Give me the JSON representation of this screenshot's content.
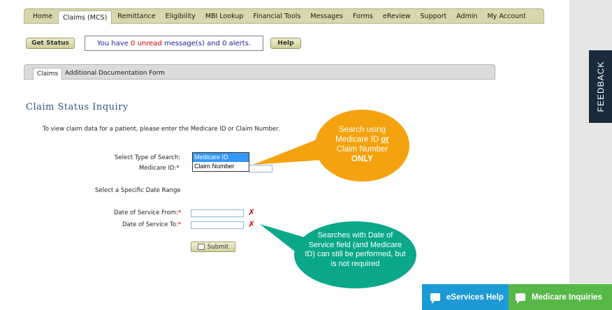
{
  "nav": {
    "items": [
      "Home",
      "Claims (MCS)",
      "Remittance",
      "Eligibility",
      "MBI Lookup",
      "Financial Tools",
      "Messages",
      "Forms",
      "eReview",
      "Support",
      "Admin",
      "My Account"
    ]
  },
  "toolbar": {
    "get_status_label": "Get Status",
    "help_label": "Help",
    "message_prefix": "You have ",
    "unread_count": "0 unread",
    "message_suffix": " message(s) and 0 alerts."
  },
  "subtabs": [
    "Claims",
    "Additional Documentation Form"
  ],
  "page": {
    "title": "Claim Status Inquiry",
    "intro": "To view claim data for a patient, please enter the Medicare ID or Claim Number."
  },
  "form": {
    "search_type_label": "Select Type of Search:",
    "medicare_id_label": "Medicare ID:",
    "search_options": [
      "Medicare ID",
      "Claim Number"
    ],
    "selected_option": "Medicare ID",
    "date_range_label": "Select a Specific Date Range",
    "dos_from_label": "Date of Service From:",
    "dos_to_label": "Date of Service To:",
    "required_mark": "*",
    "submit_label": "Submit"
  },
  "callouts": {
    "orange_line1": "Search using",
    "orange_line2": "Medicare ID",
    "orange_or": "or",
    "orange_line3": "Claim Number",
    "orange_line4": "ONLY",
    "teal_text": "Searches with Date of Service field (and Medicare ID) can still be performed, but is not required"
  },
  "side": {
    "feedback_label": "FEEDBACK",
    "eservices_help_label": "eServices Help",
    "medicare_inquiries_label": "Medicare Inquiries"
  },
  "colors": {
    "nav_bg": "#d8d7ad",
    "orange_callout": "#f4a20d",
    "teal_callout": "#0aa889",
    "feedback_bg": "#1a2a3a",
    "eservices_bg": "#1c9ad6",
    "medicare_inquiries_bg": "#57b848"
  }
}
